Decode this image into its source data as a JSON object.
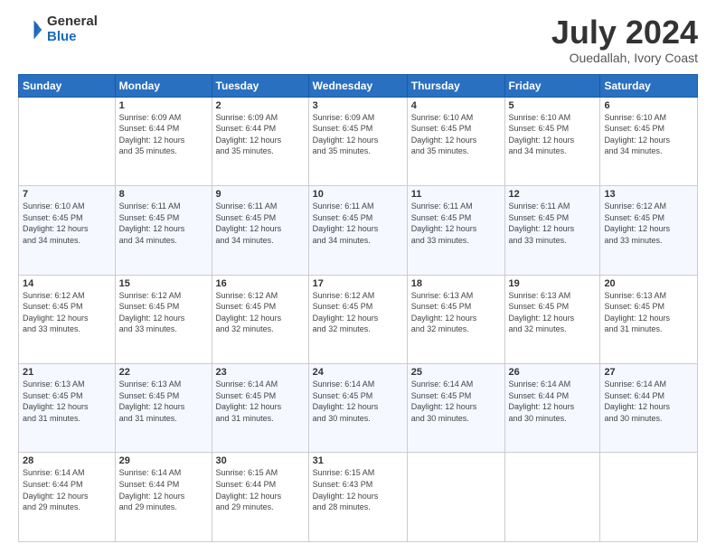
{
  "logo": {
    "general": "General",
    "blue": "Blue"
  },
  "title": "July 2024",
  "subtitle": "Ouedallah, Ivory Coast",
  "days_header": [
    "Sunday",
    "Monday",
    "Tuesday",
    "Wednesday",
    "Thursday",
    "Friday",
    "Saturday"
  ],
  "weeks": [
    [
      {
        "num": "",
        "info": ""
      },
      {
        "num": "1",
        "info": "Sunrise: 6:09 AM\nSunset: 6:44 PM\nDaylight: 12 hours\nand 35 minutes."
      },
      {
        "num": "2",
        "info": "Sunrise: 6:09 AM\nSunset: 6:44 PM\nDaylight: 12 hours\nand 35 minutes."
      },
      {
        "num": "3",
        "info": "Sunrise: 6:09 AM\nSunset: 6:45 PM\nDaylight: 12 hours\nand 35 minutes."
      },
      {
        "num": "4",
        "info": "Sunrise: 6:10 AM\nSunset: 6:45 PM\nDaylight: 12 hours\nand 35 minutes."
      },
      {
        "num": "5",
        "info": "Sunrise: 6:10 AM\nSunset: 6:45 PM\nDaylight: 12 hours\nand 34 minutes."
      },
      {
        "num": "6",
        "info": "Sunrise: 6:10 AM\nSunset: 6:45 PM\nDaylight: 12 hours\nand 34 minutes."
      }
    ],
    [
      {
        "num": "7",
        "info": ""
      },
      {
        "num": "8",
        "info": "Sunrise: 6:11 AM\nSunset: 6:45 PM\nDaylight: 12 hours\nand 34 minutes."
      },
      {
        "num": "9",
        "info": "Sunrise: 6:11 AM\nSunset: 6:45 PM\nDaylight: 12 hours\nand 34 minutes."
      },
      {
        "num": "10",
        "info": "Sunrise: 6:11 AM\nSunset: 6:45 PM\nDaylight: 12 hours\nand 34 minutes."
      },
      {
        "num": "11",
        "info": "Sunrise: 6:11 AM\nSunset: 6:45 PM\nDaylight: 12 hours\nand 33 minutes."
      },
      {
        "num": "12",
        "info": "Sunrise: 6:11 AM\nSunset: 6:45 PM\nDaylight: 12 hours\nand 33 minutes."
      },
      {
        "num": "13",
        "info": "Sunrise: 6:12 AM\nSunset: 6:45 PM\nDaylight: 12 hours\nand 33 minutes."
      }
    ],
    [
      {
        "num": "14",
        "info": ""
      },
      {
        "num": "15",
        "info": "Sunrise: 6:12 AM\nSunset: 6:45 PM\nDaylight: 12 hours\nand 33 minutes."
      },
      {
        "num": "16",
        "info": "Sunrise: 6:12 AM\nSunset: 6:45 PM\nDaylight: 12 hours\nand 32 minutes."
      },
      {
        "num": "17",
        "info": "Sunrise: 6:12 AM\nSunset: 6:45 PM\nDaylight: 12 hours\nand 32 minutes."
      },
      {
        "num": "18",
        "info": "Sunrise: 6:13 AM\nSunset: 6:45 PM\nDaylight: 12 hours\nand 32 minutes."
      },
      {
        "num": "19",
        "info": "Sunrise: 6:13 AM\nSunset: 6:45 PM\nDaylight: 12 hours\nand 32 minutes."
      },
      {
        "num": "20",
        "info": "Sunrise: 6:13 AM\nSunset: 6:45 PM\nDaylight: 12 hours\nand 31 minutes."
      }
    ],
    [
      {
        "num": "21",
        "info": ""
      },
      {
        "num": "22",
        "info": "Sunrise: 6:13 AM\nSunset: 6:45 PM\nDaylight: 12 hours\nand 31 minutes."
      },
      {
        "num": "23",
        "info": "Sunrise: 6:14 AM\nSunset: 6:45 PM\nDaylight: 12 hours\nand 31 minutes."
      },
      {
        "num": "24",
        "info": "Sunrise: 6:14 AM\nSunset: 6:45 PM\nDaylight: 12 hours\nand 30 minutes."
      },
      {
        "num": "25",
        "info": "Sunrise: 6:14 AM\nSunset: 6:45 PM\nDaylight: 12 hours\nand 30 minutes."
      },
      {
        "num": "26",
        "info": "Sunrise: 6:14 AM\nSunset: 6:44 PM\nDaylight: 12 hours\nand 30 minutes."
      },
      {
        "num": "27",
        "info": "Sunrise: 6:14 AM\nSunset: 6:44 PM\nDaylight: 12 hours\nand 30 minutes."
      }
    ],
    [
      {
        "num": "28",
        "info": "Sunrise: 6:14 AM\nSunset: 6:44 PM\nDaylight: 12 hours\nand 29 minutes."
      },
      {
        "num": "29",
        "info": "Sunrise: 6:14 AM\nSunset: 6:44 PM\nDaylight: 12 hours\nand 29 minutes."
      },
      {
        "num": "30",
        "info": "Sunrise: 6:15 AM\nSunset: 6:44 PM\nDaylight: 12 hours\nand 29 minutes."
      },
      {
        "num": "31",
        "info": "Sunrise: 6:15 AM\nSunset: 6:43 PM\nDaylight: 12 hours\nand 28 minutes."
      },
      {
        "num": "",
        "info": ""
      },
      {
        "num": "",
        "info": ""
      },
      {
        "num": "",
        "info": ""
      }
    ]
  ],
  "week7_sun_info": "Sunrise: 6:10 AM\nSunset: 6:45 PM\nDaylight: 12 hours\nand 34 minutes.",
  "week14_sun_info": "Sunrise: 6:12 AM\nSunset: 6:45 PM\nDaylight: 12 hours\nand 33 minutes.",
  "week21_sun_info": "Sunrise: 6:13 AM\nSunset: 6:45 PM\nDaylight: 12 hours\nand 31 minutes."
}
